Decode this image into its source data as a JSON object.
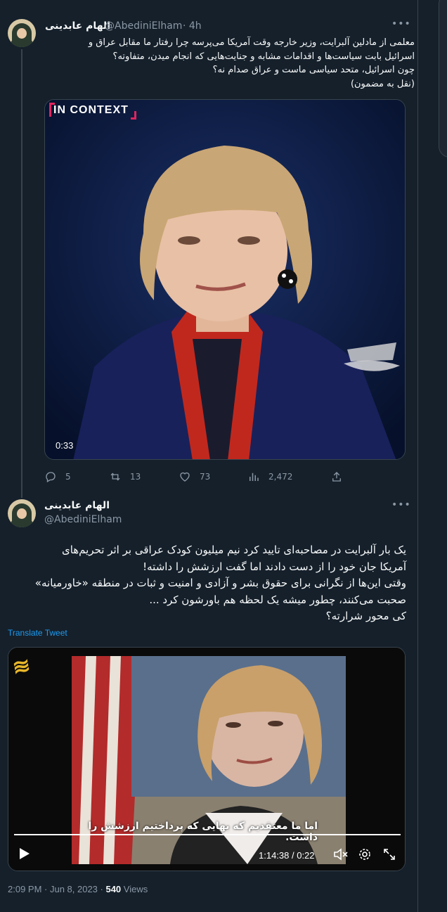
{
  "tweet1": {
    "author_name": "الهام عابدینی",
    "handle": "@AbediniElham",
    "time": "· 4h",
    "text_lines": [
      "معلمی از مادلین آلبرایت، وزیر خارجه وقت آمریکا می‌پرسه چرا رفتار ما مقابل عراق و",
      "اسرائیل بابت سیاست‌ها و اقدامات مشابه و جنایت‌هایی که انجام میدن، متفاوته؟",
      "چون اسرائیل، متحد سیاسی ماست و عراق صدام نه؟",
      "(نقل به مضمون)"
    ],
    "media": {
      "badge": "IN CONTEXT",
      "duration": "0:33"
    },
    "actions": {
      "replies": "5",
      "retweets": "13",
      "likes": "73",
      "views": "2,472"
    }
  },
  "tweet2": {
    "author_name": "الهام عابدینی",
    "handle": "@AbediniElham",
    "text_lines": [
      "یک بار آلبرایت در مصاحبه‌ای تایید کرد نیم میلیون کودک عراقی بر اثر تحریم‌های",
      "آمریکا جان خود را از دست دادند اما گفت ارزشش را داشته!",
      "وقتی این‌ها از نگرانی برای حقوق بشر و آزادی و امنیت و ثبات در منطقه «خاورمیانه»",
      "صحبت می‌کنند، چطور میشه یک لحظه هم باورشون کرد ...",
      "کی محور شرارته؟"
    ],
    "translate_label": "Translate Tweet",
    "media": {
      "subtitle": "اما ما معتقدیم که بهایی که پرداختیم ارزشش را داشت.",
      "time_display": "1:14:38 / 0:22"
    },
    "meta": {
      "timestamp": "2:09 PM · Jun 8, 2023 · ",
      "views_count": "540",
      "views_label": " Views"
    }
  },
  "colors": {
    "background": "#15202b",
    "accent": "#1d9bf0",
    "muted": "#8b98a5",
    "border": "#38444d"
  }
}
